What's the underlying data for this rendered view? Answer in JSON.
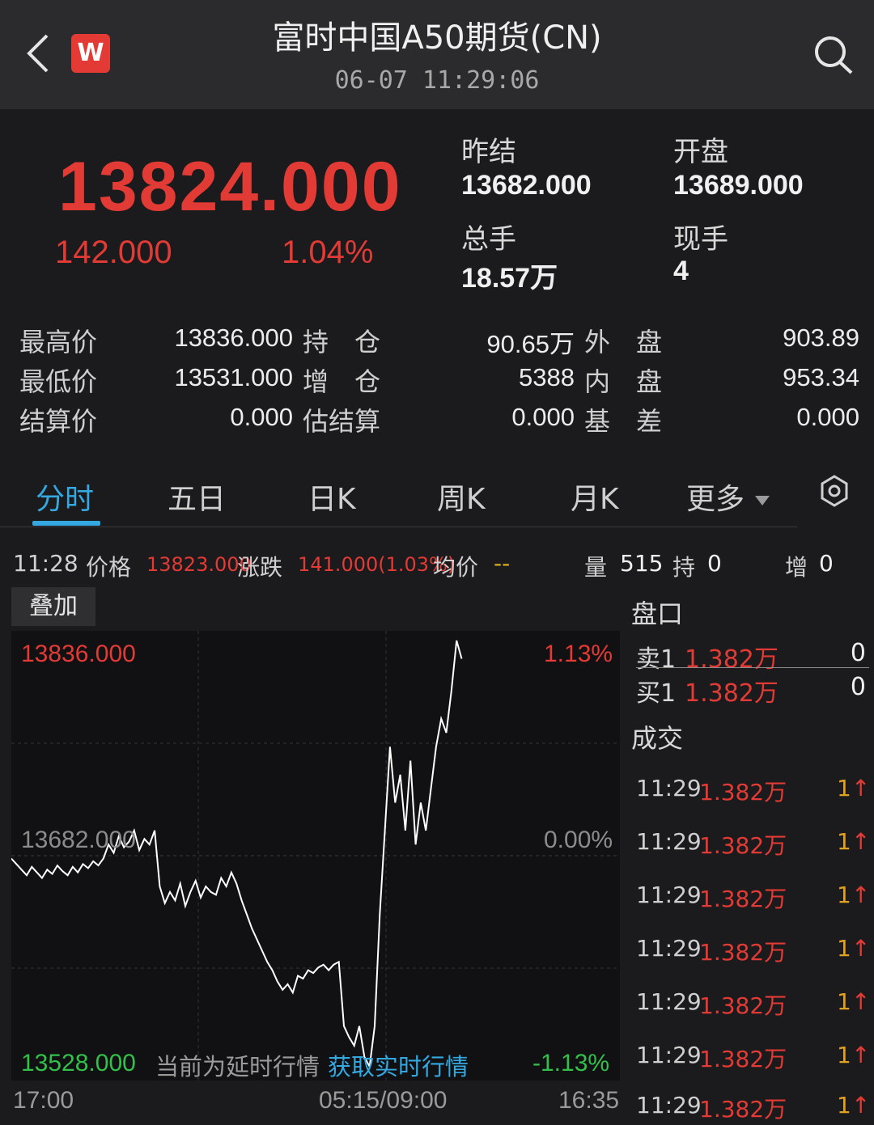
{
  "header": {
    "title": "富时中国A50期货(CN)",
    "subtitle": "06-07 11:29:06",
    "logo_text": "W"
  },
  "quote": {
    "price": "13824.000",
    "change": "142.000",
    "change_pct": "1.04%",
    "prev_settle_label": "昨结",
    "prev_settle": "13682.000",
    "open_label": "开盘",
    "open": "13689.000",
    "volume_label": "总手",
    "volume": "18.57万",
    "last_vol_label": "现手",
    "last_vol": "4"
  },
  "stats": {
    "high_label": "最高价",
    "high": "13836.000",
    "oi_label": "持　仓",
    "oi": "90.65万",
    "outer_label": "外　盘",
    "outer": "903.89",
    "low_label": "最低价",
    "low": "13531.000",
    "oi_chg_label": "增　仓",
    "oi_chg": "5388",
    "inner_label": "内　盘",
    "inner": "953.34",
    "settle_label": "结算价",
    "settle": "0.000",
    "est_settle_label": "估结算",
    "est_settle": "0.000",
    "basis_label": "基　差",
    "basis": "0.000"
  },
  "tabs": [
    "分时",
    "五日",
    "日K",
    "周K",
    "月K",
    "更多"
  ],
  "info": {
    "time": "11:28",
    "price_label": "价格",
    "price": "13823.000",
    "chg_label": "涨跌",
    "chg": "141.000(1.03%)",
    "avg_label": "均价",
    "avg": "--",
    "vol_label": "量",
    "vol": "515",
    "hold_label": "持",
    "hold": "0",
    "add_label": "增",
    "add": "0"
  },
  "overlay_button": "叠加",
  "chart_labels": {
    "y_top": "13836.000",
    "y_mid": "13682.000",
    "y_bottom": "13528.000",
    "pct_top": "1.13%",
    "pct_mid": "0.00%",
    "pct_bottom": "-1.13%",
    "delay_notice": "当前为延时行情",
    "realtime_link": "获取实时行情",
    "t_start": "17:00",
    "t_mid": "05:15/09:00",
    "t_end": "16:35"
  },
  "chart_data": {
    "type": "line",
    "title": "",
    "xlabel": "",
    "ylabel": "",
    "x_ticks": [
      "17:00",
      "05:15/09:00",
      "16:35"
    ],
    "ylim": [
      13528,
      13836
    ],
    "reference": 13682,
    "grid": true,
    "series": [
      {
        "values": [
          13680,
          13676,
          13672,
          13668,
          13674,
          13670,
          13666,
          13672,
          13669,
          13675,
          13671,
          13668,
          13674,
          13670,
          13676,
          13673,
          13678,
          13675,
          13680,
          13690,
          13684,
          13696,
          13688,
          13692,
          13700,
          13686,
          13694,
          13690,
          13700,
          13660,
          13648,
          13656,
          13650,
          13662,
          13646,
          13656,
          13664,
          13652,
          13660,
          13656,
          13654,
          13666,
          13660,
          13670,
          13662,
          13650,
          13640,
          13630,
          13622,
          13614,
          13606,
          13600,
          13592,
          13586,
          13590,
          13584,
          13596,
          13594,
          13600,
          13598,
          13602,
          13604,
          13600,
          13604,
          13606,
          13560,
          13552,
          13546,
          13560,
          13538,
          13531,
          13560,
          13640,
          13700,
          13760,
          13720,
          13740,
          13700,
          13750,
          13690,
          13720,
          13700,
          13730,
          13760,
          13780,
          13770,
          13800,
          13836,
          13823
        ]
      }
    ]
  },
  "orderbook": {
    "title": "盘口",
    "ask_label": "卖1",
    "ask_price": "1.382万",
    "ask_vol": "0",
    "bid_label": "买1",
    "bid_price": "1.382万",
    "bid_vol": "0"
  },
  "trades": {
    "title": "成交",
    "rows": [
      {
        "time": "11:29",
        "price": "1.382万",
        "vol": "1",
        "arrow": "↑"
      },
      {
        "time": "11:29",
        "price": "1.382万",
        "vol": "1",
        "arrow": "↑"
      },
      {
        "time": "11:29",
        "price": "1.382万",
        "vol": "1",
        "arrow": "↑"
      },
      {
        "time": "11:29",
        "price": "1.382万",
        "vol": "1",
        "arrow": "↑"
      },
      {
        "time": "11:29",
        "price": "1.382万",
        "vol": "1",
        "arrow": "↑"
      },
      {
        "time": "11:29",
        "price": "1.382万",
        "vol": "1",
        "arrow": "↑"
      },
      {
        "time": "11:29",
        "price": "1.382万",
        "vol": "1",
        "arrow": "↑"
      }
    ]
  },
  "colors": {
    "up": "#e23a35",
    "down": "#33c04a",
    "accent": "#34a8e0",
    "line": "#ffffff"
  },
  "icons": [
    "back-arrow-icon",
    "search-icon",
    "dropdown-caret-icon",
    "settings-gear-icon",
    "up-arrow-icon"
  ]
}
